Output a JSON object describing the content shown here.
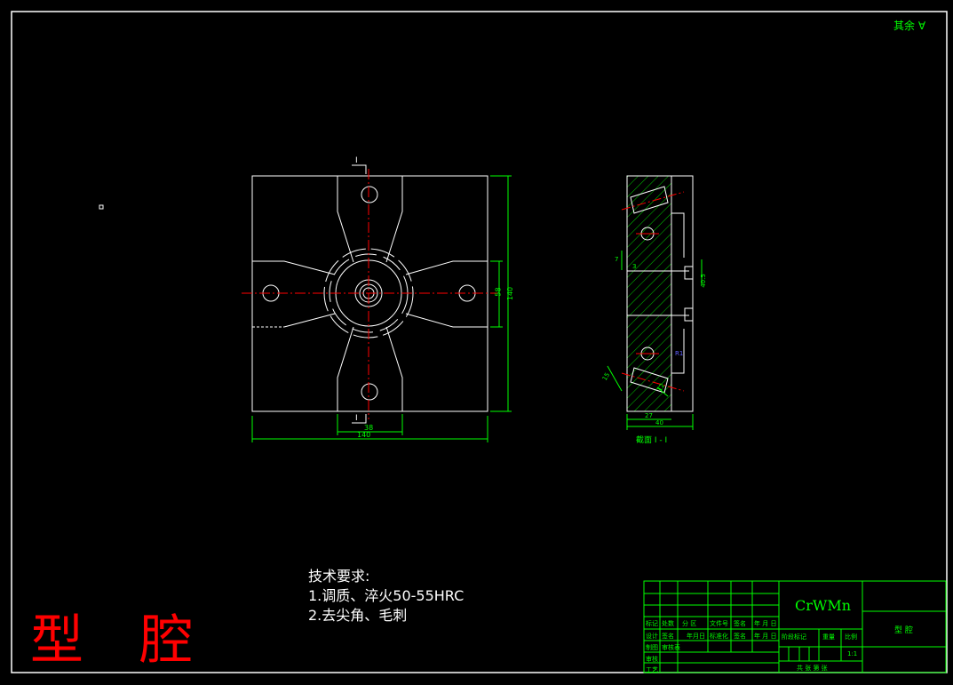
{
  "colors": {
    "background": "#000000",
    "outline": "#ffffff",
    "dimension": "#00ff00",
    "centerline": "#ff0000",
    "title": "#ff0000"
  },
  "surface_note": "其余",
  "front_view": {
    "section_mark_top": "I",
    "section_mark_bottom": "I",
    "dim_width": "140",
    "dim_inner": "38",
    "dim_height": "140",
    "dim_mid": "58"
  },
  "side_view": {
    "dim_top": "7",
    "dim_small": "3",
    "dim_side": "40.5",
    "dim_bottom_a": "27",
    "dim_bottom_b": "40",
    "dim_angle_a": "15",
    "dim_angle_b": "12",
    "dim_r": "R1",
    "caption": "截面  I - I"
  },
  "tech_requirements": {
    "heading": "技术要求:",
    "items": [
      "1.调质、淬火50-55HRC",
      "2.去尖角、毛刺"
    ]
  },
  "big_title": "型 腔",
  "title_block": {
    "material": "CrWMn",
    "part_name": "型 腔",
    "row1": [
      "标记",
      "处数",
      "分 区",
      "文件号",
      "签名",
      "年 月 日"
    ],
    "row2": [
      "设计",
      "签名",
      "年月日",
      "标准化",
      "签名",
      "年 月 日"
    ],
    "row3": [
      "制图",
      "审核表"
    ],
    "row4": [
      "审核"
    ],
    "row5": [
      "工艺"
    ],
    "stage_label": "阶段标记",
    "weight_label": "重量",
    "scale_label": "比例",
    "scale_value": "1:1",
    "sheet_label": "共  张 第 张"
  }
}
